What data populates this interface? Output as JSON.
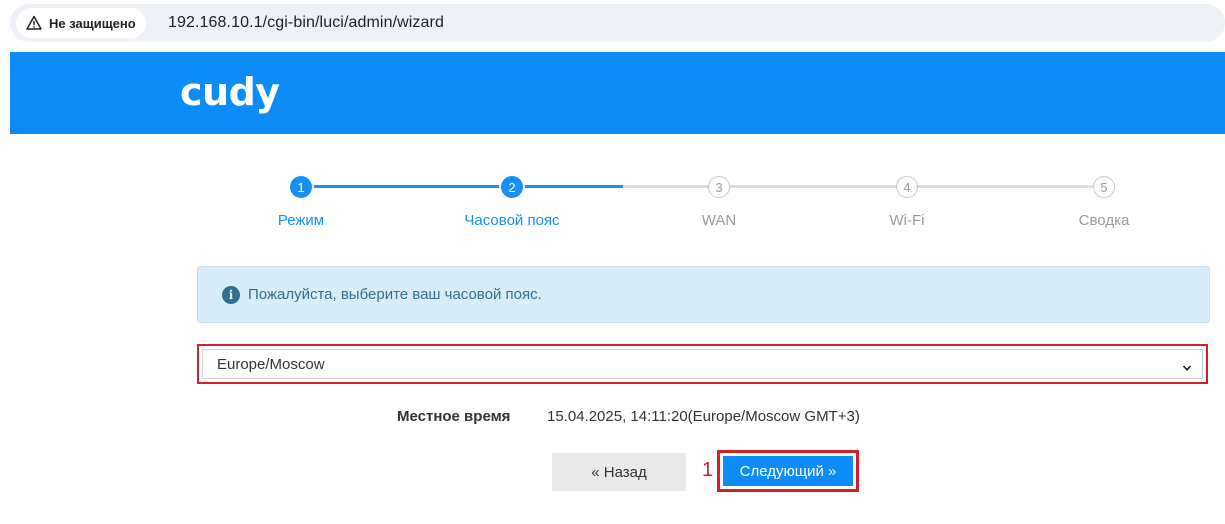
{
  "browser": {
    "security_label": "Не защищено",
    "url": "192.168.10.1/cgi-bin/luci/admin/wizard"
  },
  "header": {
    "logo_text": "cudy",
    "color": "#0b8cf6"
  },
  "wizard": {
    "steps": [
      {
        "num": "1",
        "label": "Режим",
        "state": "done"
      },
      {
        "num": "2",
        "label": "Часовой пояс",
        "state": "current"
      },
      {
        "num": "3",
        "label": "WAN",
        "state": "todo"
      },
      {
        "num": "4",
        "label": "Wi-Fi",
        "state": "todo"
      },
      {
        "num": "5",
        "label": "Сводка",
        "state": "todo"
      }
    ],
    "info_message": "Пожалуйста, выберите ваш часовой пояс.",
    "timezone_select": {
      "value": "Europe/Moscow"
    },
    "local_time": {
      "label": "Местное время",
      "value": "15.04.2025, 14:11:20(Europe/Moscow GMT+3)"
    },
    "buttons": {
      "back_label": "« Назад",
      "next_label": "Следующий »"
    },
    "annotation": "1"
  },
  "colors": {
    "accent": "#1690f5",
    "highlight": "#d0202c"
  }
}
